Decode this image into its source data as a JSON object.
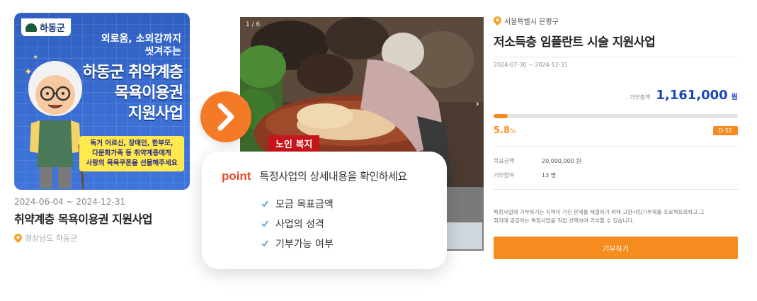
{
  "left_card": {
    "poster": {
      "logo_text": "하동군",
      "subtitle_lines": [
        "외로움, 소외감까지",
        "씻겨주는"
      ],
      "headline_lines": [
        "하동군 취약계층",
        "목욕이용권",
        "지원사업"
      ],
      "box_lines": [
        "독거 어르신, 장애인, 한부모,",
        "다문화가족 등 취약계층에게",
        "사랑의 목욕쿠폰을 선물해주세요"
      ]
    },
    "date": "2024-06-04 ~ 2024-12-31",
    "title": "취약계층 목욕이용권 지원사업",
    "location": "경상남도 하동군"
  },
  "arrow": {
    "icon": "chevron-right-icon",
    "color": "#f47a28"
  },
  "photo": {
    "counter": "1 / 6",
    "tag": "노인 복지"
  },
  "point_popup": {
    "keyword": "point",
    "description": "특정사업의 상세내용을 확인하세요",
    "items": [
      "모금 목표금액",
      "사업의 성격",
      "기부가능 여부"
    ]
  },
  "detail": {
    "location": "서울특별시 은평구",
    "title": "저소득층 임플란트 시술 지원사업",
    "period": "2024-07-30 ~ 2024-12-31",
    "amount_label": "기부총액",
    "amount": "1,161,000",
    "amount_unit": "원",
    "progress_fraction": 0.058,
    "percent": "5.8",
    "percent_unit": "%",
    "dday": "D-55",
    "info": [
      {
        "label": "목표금액",
        "value": "20,000,000 원"
      },
      {
        "label": "기부참여",
        "value": "13 명"
      }
    ],
    "notice_lines": [
      "특정사업에 기부하기는 지역이 가진 문제를 해결하기 위해 고향사랑기부제를 프로젝트화하고 그",
      "취지에 공감하는 특정사업을 직접 선택하여 기부할 수 있습니다."
    ],
    "donate_label": "기부하기",
    "accent_color": "#f68b1f",
    "amount_color": "#1c48b8"
  }
}
